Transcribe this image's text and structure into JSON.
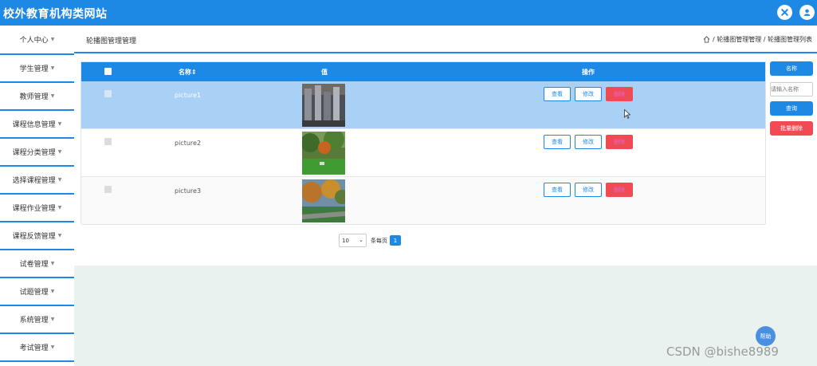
{
  "header": {
    "site_title": "校外教育机构类网站"
  },
  "sidebar": {
    "items": [
      {
        "label": "个人中心"
      },
      {
        "label": "学生管理"
      },
      {
        "label": "教师管理"
      },
      {
        "label": "课程信息管理"
      },
      {
        "label": "课程分类管理"
      },
      {
        "label": "选择课程管理"
      },
      {
        "label": "课程作业管理"
      },
      {
        "label": "课程反馈管理"
      },
      {
        "label": "试卷管理"
      },
      {
        "label": "试题管理"
      },
      {
        "label": "系统管理"
      },
      {
        "label": "考试管理"
      }
    ]
  },
  "page": {
    "title": "轮播图管理管理",
    "breadcrumb": [
      "轮播图管理管理",
      "轮播图管理列表"
    ]
  },
  "table": {
    "columns": [
      "名称⇕",
      "值",
      "操作"
    ],
    "rows": [
      {
        "name": "picture1",
        "selected": true
      },
      {
        "name": "picture2",
        "selected": false
      },
      {
        "name": "picture3",
        "selected": false
      }
    ],
    "actions": {
      "view": "查看",
      "edit": "修改",
      "delete": "删除"
    }
  },
  "search": {
    "label": "名称",
    "placeholder": "请输入名称",
    "query_button": "查询",
    "batch_delete": "批量删除"
  },
  "pagination": {
    "page_size": "10",
    "per_page_label": "条每页",
    "current_page": "1"
  },
  "float_button": "帮助",
  "watermark": "CSDN @bishe8989",
  "colors": {
    "primary": "#1e88e5",
    "danger": "#f04a54",
    "selected_row": "#a9d1f5"
  }
}
